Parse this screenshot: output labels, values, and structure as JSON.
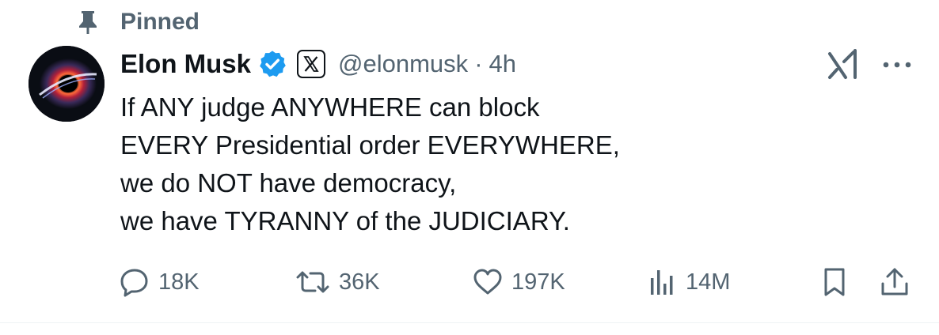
{
  "pinned": {
    "label": "Pinned",
    "icon": "pin-icon"
  },
  "author": {
    "display_name": "Elon Musk",
    "handle": "@elonmusk",
    "separator": "·",
    "time": "4h",
    "verified_icon": "verified-badge-icon",
    "affiliation_icon": "x-logo-icon"
  },
  "tweet": {
    "lines": [
      "If ANY judge ANYWHERE can block",
      "EVERY Presidential order EVERYWHERE,",
      "we do NOT have democracy,",
      "we have TYRANNY of the JUDICIARY."
    ]
  },
  "actions": {
    "replies": {
      "icon": "reply-icon",
      "count": "18K"
    },
    "reposts": {
      "icon": "repost-icon",
      "count": "36K"
    },
    "likes": {
      "icon": "heart-icon",
      "count": "197K"
    },
    "views": {
      "icon": "views-icon",
      "count": "14M"
    },
    "bookmark": {
      "icon": "bookmark-icon"
    },
    "share": {
      "icon": "share-icon"
    }
  },
  "menu": {
    "grok_icon": "grok-icon",
    "more_icon": "more-icon"
  },
  "colors": {
    "text_primary": "#0f1419",
    "text_secondary": "#536471",
    "verified_blue": "#1d9bf0",
    "divider": "#eff3f4"
  }
}
